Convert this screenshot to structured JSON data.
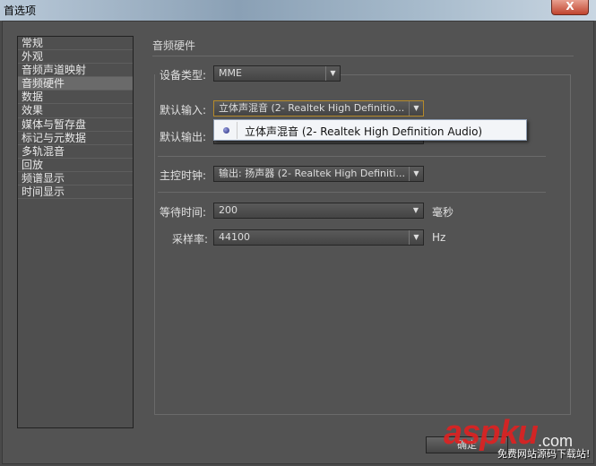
{
  "window": {
    "title": "首选项",
    "close": "X"
  },
  "sidebar": {
    "items": [
      "常规",
      "外观",
      "音频声道映射",
      "音频硬件",
      "数据",
      "效果",
      "媒体与暂存盘",
      "标记与元数据",
      "多轨混音",
      "回放",
      "频谱显示",
      "时间显示"
    ],
    "selected": "音频硬件"
  },
  "main": {
    "title": "音频硬件",
    "device_type": {
      "label": "设备类型:",
      "value": "MME"
    },
    "default_input": {
      "label": "默认输入:",
      "value": "立体声混音 (2- Realtek High Definitio..."
    },
    "default_output": {
      "label": "默认输出:"
    },
    "popup": {
      "option": "立体声混音 (2- Realtek High Definition Audio)"
    },
    "master_clock": {
      "label": "主控时钟:",
      "value": "输出: 扬声器 (2- Realtek High Definiti..."
    },
    "latency": {
      "label": "等待时间:",
      "value": "200",
      "unit": "毫秒"
    },
    "sample_rate": {
      "label": "采样率:",
      "value": "44100",
      "unit": "Hz"
    }
  },
  "footer": {
    "ok": "确定"
  },
  "watermark": {
    "brand": "aspku",
    "domain": ".com",
    "tagline": "免费网站源码下载站!"
  }
}
